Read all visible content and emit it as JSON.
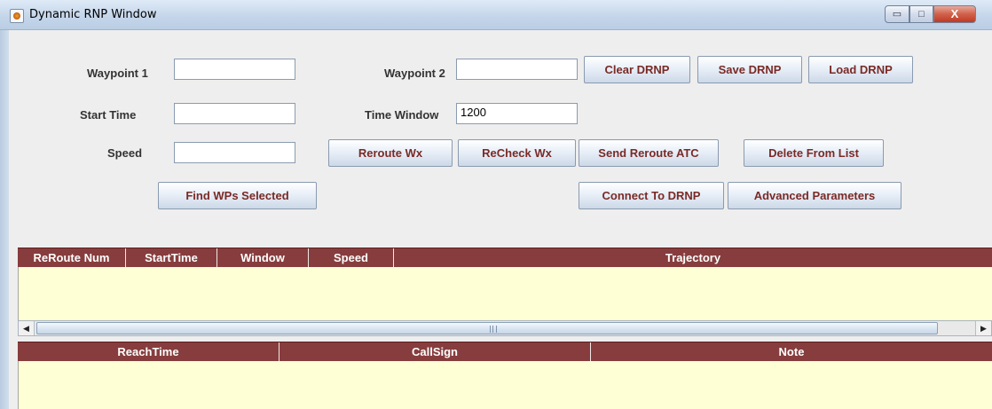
{
  "window": {
    "title": "Dynamic RNP Window",
    "minimize_glyph": "▭",
    "maximize_glyph": "□",
    "close_glyph": "X"
  },
  "form": {
    "waypoint1_label": "Waypoint 1",
    "waypoint1_value": "",
    "waypoint2_label": "Waypoint 2",
    "waypoint2_value": "",
    "start_time_label": "Start Time",
    "start_time_value": "",
    "time_window_label": "Time Window",
    "time_window_value": "1200",
    "speed_label": "Speed",
    "speed_value": ""
  },
  "buttons": {
    "clear_drnp": "Clear DRNP",
    "save_drnp": "Save DRNP",
    "load_drnp": "Load DRNP",
    "reroute_wx": "Reroute Wx",
    "recheck_wx": "ReCheck Wx",
    "send_reroute_atc": "Send Reroute ATC",
    "delete_from_list": "Delete From List",
    "find_wps_selected": "Find WPs Selected",
    "connect_to_drnp": "Connect To DRNP",
    "advanced_parameters": "Advanced Parameters"
  },
  "reroute_table": {
    "columns": [
      "ReRoute Num",
      "StartTime",
      "Window",
      "Speed",
      "Trajectory"
    ],
    "rows": []
  },
  "reach_table": {
    "columns": [
      "ReachTime",
      "CallSign",
      "Note"
    ],
    "rows": []
  },
  "scrollbar": {
    "left_arrow": "◀",
    "right_arrow": "▶"
  },
  "colors": {
    "header_bg": "#873d3d",
    "table_body_bg": "#ffffd6",
    "button_text": "#7a2a26"
  }
}
